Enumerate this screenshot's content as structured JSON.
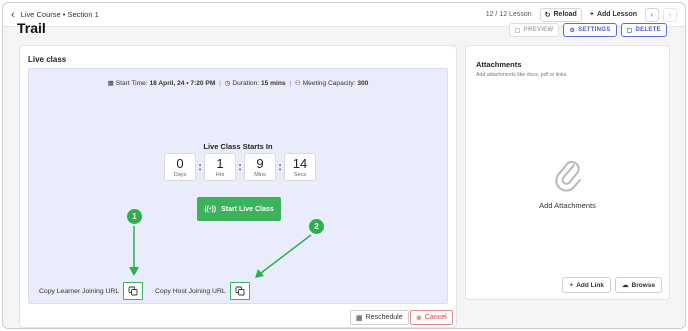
{
  "header": {
    "breadcrumb": "Live Course • Section 1",
    "lesson_count": "12 / 12 Lesson",
    "reload_label": "Reload",
    "add_lesson_label": "Add Lesson"
  },
  "page": {
    "title": "Trail",
    "preview_label": "PREVIEW",
    "settings_label": "SETTINGS",
    "delete_label": "DELETE"
  },
  "live_class": {
    "title": "Live class",
    "start_time_label": "Start Time:",
    "start_time_value": "18 April, 24 • 7:20 PM",
    "duration_label": "Duration:",
    "duration_value": "15 mins",
    "capacity_label": "Meeting Capacity:",
    "capacity_value": "300",
    "starts_in_label": "Live Class Starts In",
    "countdown": [
      {
        "value": "0",
        "unit": "Days"
      },
      {
        "value": "1",
        "unit": "Hrs"
      },
      {
        "value": "9",
        "unit": "Mins"
      },
      {
        "value": "14",
        "unit": "Secs"
      }
    ],
    "start_button_label": "Start Live Class",
    "copy_learner_label": "Copy Learner Joining URL",
    "copy_host_label": "Copy Host Joining URL",
    "callouts": [
      "1",
      "2"
    ],
    "reschedule_label": "Reschedule",
    "cancel_label": "Cancel"
  },
  "attachments": {
    "title": "Attachments",
    "subtitle": "Add attachments like docs, pdf or links",
    "empty_label": "Add Attachments",
    "add_link_label": "Add Link",
    "browse_label": "Browse"
  },
  "colors": {
    "accent_green": "#3bb25b",
    "accent_blue": "#4a5bc9",
    "danger_red": "#d04444",
    "live_area_bg": "#e9edfb"
  }
}
